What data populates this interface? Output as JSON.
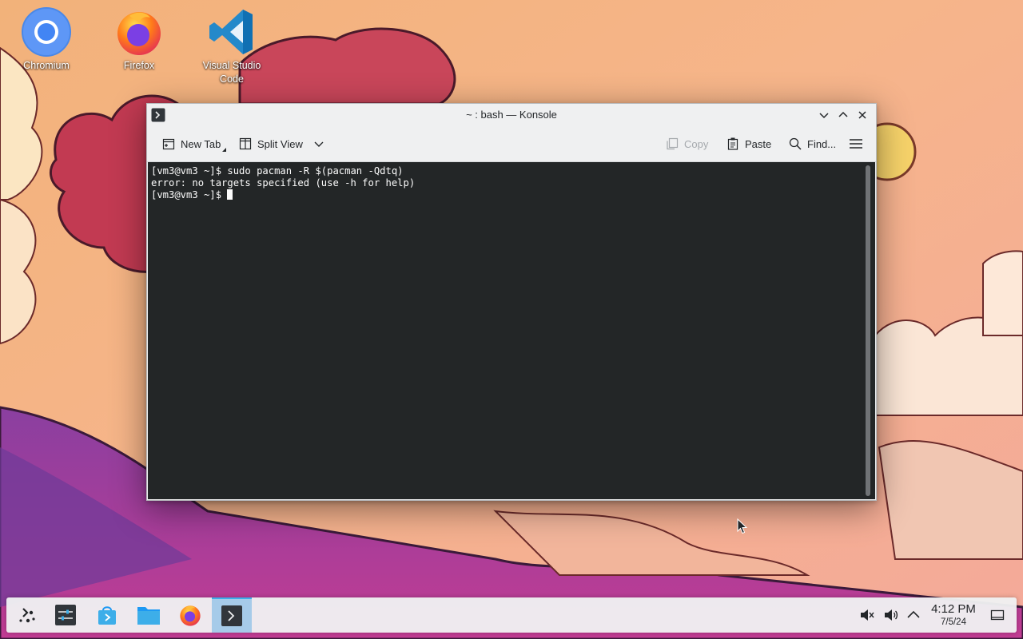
{
  "desktop": {
    "icons": [
      {
        "label": "Chromium",
        "icon": "chromium-icon"
      },
      {
        "label": "Firefox",
        "icon": "firefox-icon"
      },
      {
        "label_line1": "Visual Studio",
        "label_line2": "Code",
        "icon": "vscode-icon"
      }
    ]
  },
  "window": {
    "title": "~ : bash — Konsole",
    "toolbar": {
      "new_tab": "New Tab",
      "split_view": "Split View",
      "copy": "Copy",
      "paste": "Paste",
      "find": "Find..."
    },
    "terminal": {
      "lines": [
        "[vm3@vm3 ~]$ sudo pacman -R $(pacman -Qdtq)",
        "error: no targets specified (use -h for help)",
        "[vm3@vm3 ~]$ "
      ]
    }
  },
  "taskbar": {
    "clock_time": "4:12 PM",
    "clock_date": "7/5/24",
    "items": [
      "application-launcher-icon",
      "system-settings-icon",
      "discover-store-icon",
      "file-manager-icon",
      "firefox-icon",
      "konsole-icon"
    ],
    "active_item": "konsole"
  },
  "colors": {
    "terminal_bg": "#232627",
    "terminal_fg": "#fcfcfc",
    "accent": "#3daee9",
    "window_bg": "#eff0f1"
  }
}
